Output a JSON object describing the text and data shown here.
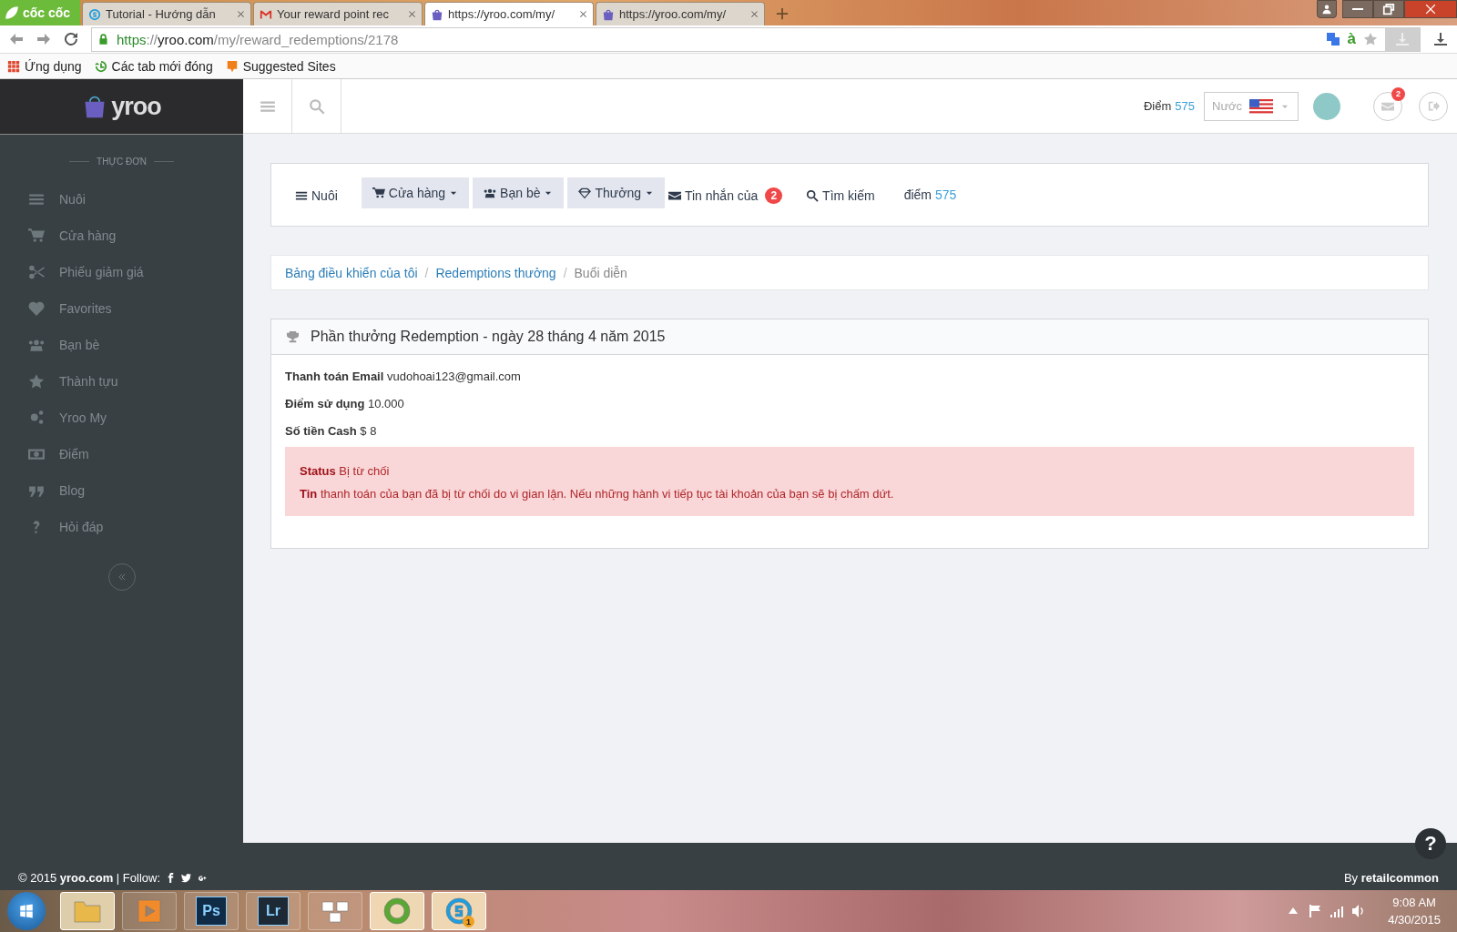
{
  "browser": {
    "brand": "cốc cốc",
    "tabs": [
      {
        "title": "Tutorial - Hướng dẫn",
        "kind": "skype",
        "selected": false
      },
      {
        "title": "Your reward point rec",
        "kind": "mail",
        "selected": false
      },
      {
        "title": "https://yroo.com/my/",
        "kind": "bag",
        "selected": true
      },
      {
        "title": "https://yroo.com/my/",
        "kind": "bag",
        "selected": false
      }
    ],
    "address": {
      "scheme": "https",
      "separator": "://",
      "host": "yroo.com",
      "path": "/my/reward_redemptions/2178"
    },
    "extension_glyph": "à",
    "bookmarks": [
      {
        "label": "Ứng dụng",
        "kind": "apps"
      },
      {
        "label": "Các tab mới đóng",
        "kind": "history"
      },
      {
        "label": "Suggested Sites",
        "kind": "suggest"
      }
    ]
  },
  "header": {
    "logo": "yroo",
    "points_label": "Điểm",
    "points_value": "575",
    "country_placeholder": "Nước",
    "mail_badge": "2"
  },
  "sidebar": {
    "heading": "THỰC ĐƠN",
    "items": [
      {
        "label": "Nuôi",
        "kind": "bars"
      },
      {
        "label": "Cửa hàng",
        "kind": "cart"
      },
      {
        "label": "Phiếu giảm giá",
        "kind": "scissors"
      },
      {
        "label": "Favorites",
        "kind": "heart"
      },
      {
        "label": "Bạn bè",
        "kind": "users"
      },
      {
        "label": "Thành tựu",
        "kind": "star"
      },
      {
        "label": "Yroo My",
        "kind": "cogs"
      },
      {
        "label": "Điểm",
        "kind": "money"
      },
      {
        "label": "Blog",
        "kind": "quote"
      },
      {
        "label": "Hỏi đáp",
        "kind": "question"
      }
    ]
  },
  "nav": {
    "items": [
      {
        "kind": "link",
        "label": "Nuôi"
      },
      {
        "kind": "dropdown",
        "label": "Cửa hàng"
      },
      {
        "kind": "dropdown",
        "label": "Bạn bè"
      },
      {
        "kind": "dropdown",
        "label": "Thưởng"
      },
      {
        "kind": "link",
        "label": "Tin nhắn của",
        "badge": "2"
      },
      {
        "kind": "link",
        "label": "Tìm kiếm"
      },
      {
        "kind": "points",
        "label": "điểm",
        "value": "575"
      }
    ]
  },
  "breadcrumb": {
    "separator": "/",
    "items": [
      {
        "label": "Bảng điều khiển của tôi",
        "active": false
      },
      {
        "label": "Redemptions thưởng",
        "active": false
      },
      {
        "label": "Buổi diễn",
        "active": true
      }
    ]
  },
  "panel": {
    "title": "Phần thưởng Redemption - ngày 28 tháng 4 năm 2015",
    "fields": [
      {
        "label": "Thanh toán Email",
        "value": "vudohoai123@gmail.com"
      },
      {
        "label": "Điểm sử dụng",
        "value": "10.000"
      },
      {
        "label": "Số tiền Cash",
        "value": "$ 8"
      }
    ],
    "alert": [
      "**Status** Bị từ chối",
      "**Tin** thanh toán của bạn đã bị từ chối do vi gian lận. Nếu những hành vi tiếp tục tài khoản của bạn sẽ bị chấm dứt."
    ]
  },
  "footer": {
    "left": "© 2015 **yroo.com** | Follow:",
    "right": "By **retailcommon**",
    "help": "?"
  },
  "taskbar": {
    "apps": [
      {
        "kind": "folder",
        "selected": true
      },
      {
        "kind": "media",
        "selected": false
      },
      {
        "kind": "photoshop",
        "label": "Ps",
        "selected": false
      },
      {
        "kind": "lightroom",
        "label": "Lr",
        "selected": false
      },
      {
        "kind": "keyboard",
        "selected": false
      },
      {
        "kind": "coccoc",
        "selected": true
      },
      {
        "kind": "skype",
        "badge": "1",
        "selected": true
      }
    ],
    "time": "9:08 AM",
    "date": "4/30/2015"
  }
}
